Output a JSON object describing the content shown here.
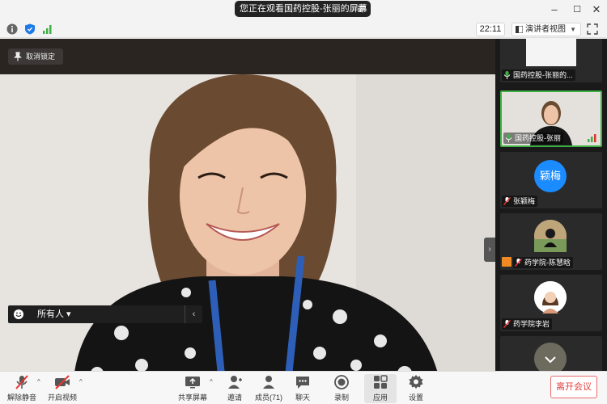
{
  "window": {
    "title": "您正在观看国药控股-张丽的屏幕",
    "minimize": "–",
    "maximize": "☐",
    "close": "✕"
  },
  "statusbar": {
    "time": "22:11",
    "view_mode": "演讲者视图"
  },
  "main": {
    "unlock_label": "取消锁定",
    "chat_target": "所有人 ▾"
  },
  "participants": [
    {
      "label": "国药控股-张丽的...",
      "type": "screen"
    },
    {
      "label": "国药控股-张丽",
      "type": "video"
    },
    {
      "label": "张颖梅",
      "avatar_text": "颖梅",
      "avatar_color": "#1a8cff",
      "type": "avatar"
    },
    {
      "label": "药学院-陈慧晗",
      "type": "photo"
    },
    {
      "label": "药学院李岩",
      "type": "photo"
    },
    {
      "label": "",
      "type": "photo"
    }
  ],
  "toolbar": {
    "unmute": "解除静音",
    "start_video": "开启视频",
    "share_screen": "共享屏幕",
    "invite": "邀请",
    "members": "成员(71)",
    "chat": "聊天",
    "record": "录制",
    "apps": "应用",
    "settings": "设置",
    "leave": "离开会议"
  },
  "colors": {
    "accent_green": "#3fb045",
    "leave_red": "#e0403f",
    "avatar_blue": "#1a8cff"
  }
}
